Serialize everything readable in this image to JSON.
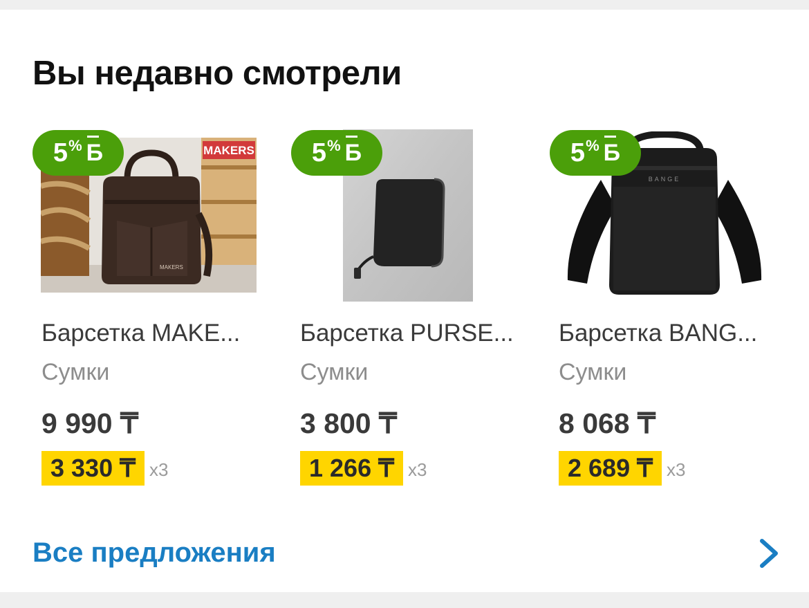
{
  "section": {
    "title": "Вы недавно смотрели"
  },
  "products": [
    {
      "bonus_percent": "5",
      "bonus_percent_sign": "%",
      "bonus_currency": "Б",
      "name": "Барсетка MAKE...",
      "category": "Сумки",
      "price": "9 990 ₸",
      "installment_price": "3 330 ₸",
      "installment_multiplier": "х3",
      "image_label": "MAKERS",
      "bag_label": "MAKERS"
    },
    {
      "bonus_percent": "5",
      "bonus_percent_sign": "%",
      "bonus_currency": "Б",
      "name": "Барсетка PURSE...",
      "category": "Сумки",
      "price": "3 800 ₸",
      "installment_price": "1 266 ₸",
      "installment_multiplier": "х3"
    },
    {
      "bonus_percent": "5",
      "bonus_percent_sign": "%",
      "bonus_currency": "Б",
      "name": "Барсетка BANG...",
      "category": "Сумки",
      "price": "8 068 ₸",
      "installment_price": "2 689 ₸",
      "installment_multiplier": "х3",
      "bag_label": "BANGE"
    }
  ],
  "footer": {
    "all_offers_label": "Все предложения"
  },
  "colors": {
    "bonus_green": "#4b9f0a",
    "installment_yellow": "#ffd500",
    "link_blue": "#1a7ec3"
  }
}
